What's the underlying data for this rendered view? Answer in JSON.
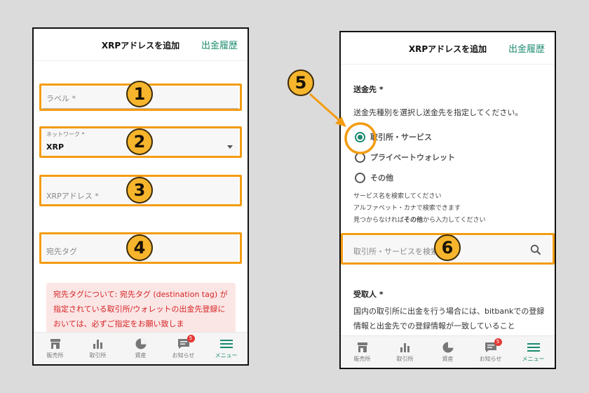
{
  "left": {
    "header": {
      "title": "XRPアドレスを追加",
      "link": "出金履歴"
    },
    "label_field": {
      "placeholder": "ラベル *"
    },
    "network_field": {
      "label": "ネットワーク *",
      "value": "XRP"
    },
    "address_field": {
      "placeholder": "XRPアドレス *"
    },
    "tag_field": {
      "placeholder": "宛先タグ"
    },
    "notice": "宛先タグについて: 宛先タグ (destination tag) が指定されている取引所/ウォレットの出金先登録においては、必ずご指定をお願い致しま"
  },
  "right": {
    "header": {
      "title": "XRPアドレスを追加",
      "link": "出金履歴"
    },
    "destination_title": "送金先 *",
    "destination_desc": "送金先種別を選択し送金先を指定してください。",
    "options": [
      "取引所・サービス",
      "プライベートウォレット",
      "その他"
    ],
    "selected_option": "取引所・サービス",
    "hint1": "サービス名を検索してください",
    "hint2": "アルファベット・カナで検索できます",
    "hint3_a": "見つからなければ",
    "hint3_b": "その他",
    "hint3_c": "から入力してください",
    "search_placeholder": "取引所・サービスを検索",
    "recipient_title": "受取人 *",
    "recipient_text": "国内の取引所に出金を行う場合には、bitbankでの登録情報と出金先での登録情報が一致していること"
  },
  "nav": {
    "items": [
      "販売所",
      "取引所",
      "資産",
      "お知らせ",
      "メニュー"
    ],
    "badge": "5"
  },
  "markers": [
    "1",
    "2",
    "3",
    "4",
    "5",
    "6"
  ],
  "colors": {
    "accent": "#1a8a6e",
    "highlight": "#f39c12",
    "warning": "#d62424",
    "badge": "#e53935"
  }
}
